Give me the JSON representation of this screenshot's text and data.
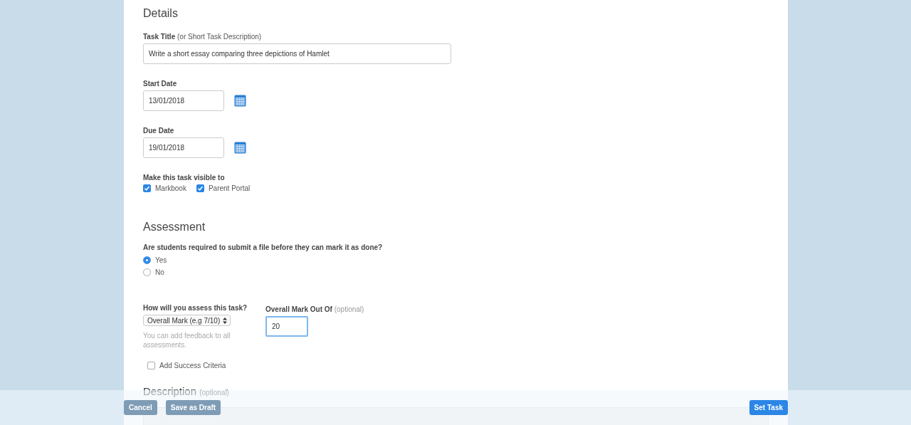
{
  "details": {
    "heading": "Details",
    "task_title": {
      "label": "Task Title",
      "hint": "(or Short Task Description)",
      "value": "Write a short essay comparing three depictions of Hamlet"
    },
    "start_date": {
      "label": "Start Date",
      "value": "13/01/2018"
    },
    "due_date": {
      "label": "Due Date",
      "value": "19/01/2018"
    },
    "visibility": {
      "label": "Make this task visible to",
      "options": [
        {
          "label": "Markbook",
          "checked": true
        },
        {
          "label": "Parent Portal",
          "checked": true
        }
      ]
    }
  },
  "assessment": {
    "heading": "Assessment",
    "question": "Are students required to submit a file before they can mark it as done?",
    "choices": [
      {
        "label": "Yes",
        "selected": true
      },
      {
        "label": "No",
        "selected": false
      }
    ],
    "method": {
      "label": "How will you assess this task?",
      "value": "Overall Mark (e.g 7/10)",
      "help": "You can add feedback to all assessments."
    },
    "mark": {
      "label": "Overall Mark Out Of",
      "hint": "(optional)",
      "value": "20"
    },
    "success_criteria": {
      "label": "Add Success Criteria",
      "checked": false
    }
  },
  "description": {
    "heading": "Description",
    "hint": "(optional)"
  },
  "actions": [
    {
      "label": "Cancel",
      "kind": "secondary"
    },
    {
      "label": "Save as Draft",
      "kind": "secondary"
    },
    {
      "label": "Set Task",
      "kind": "primary"
    }
  ]
}
